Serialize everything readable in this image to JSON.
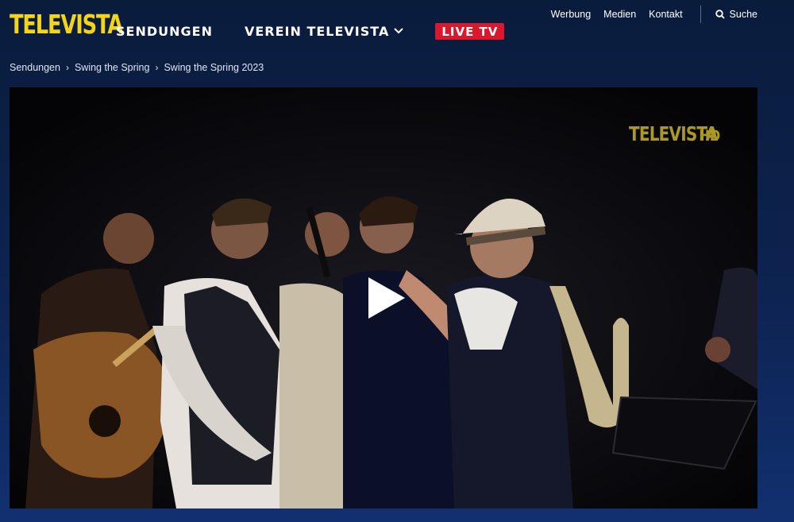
{
  "brand": {
    "logo_text": "TELEVISTA",
    "logo_color": "#f3d416"
  },
  "main_nav": {
    "items": [
      {
        "label": "SENDUNGEN"
      },
      {
        "label": "VEREIN TELEVISTA",
        "has_dropdown": true
      }
    ],
    "live_label": "LIVE TV",
    "live_color": "#d9182d"
  },
  "top_nav": {
    "links": [
      "Werbung",
      "Medien",
      "Kontakt"
    ],
    "search_label": "Suche",
    "search_icon": "search-icon"
  },
  "breadcrumb": [
    "Sendungen",
    "Swing the Spring",
    "Swing the Spring 2023"
  ],
  "video": {
    "watermark_logo": "TELEVISTA",
    "watermark_hd": "HD",
    "play_icon": "play-icon"
  }
}
